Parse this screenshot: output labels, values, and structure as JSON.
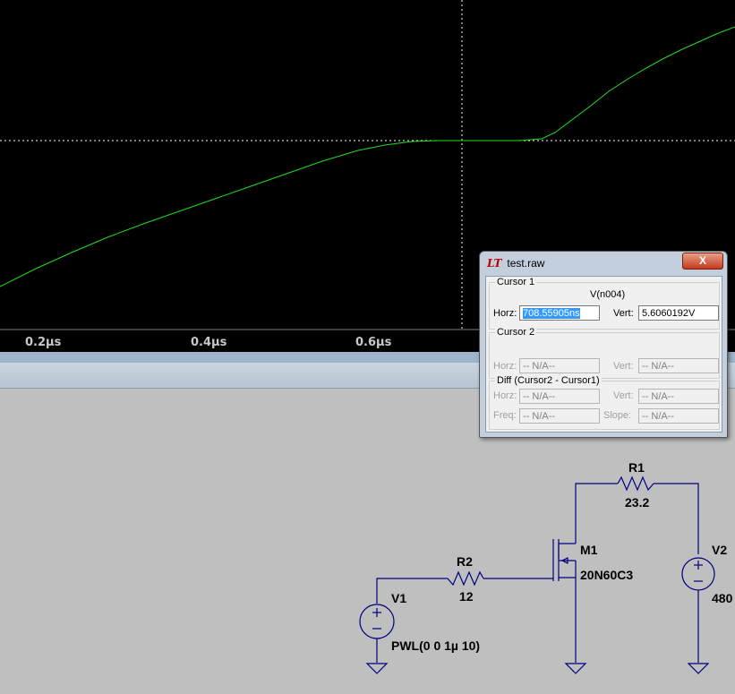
{
  "plot": {
    "x_ticks": [
      "0.2µs",
      "0.4µs",
      "0.6µs"
    ],
    "trace_color": "#00ff00",
    "background": "#000000"
  },
  "chart_data": {
    "type": "line",
    "series": [
      {
        "name": "V(n004)",
        "x": [
          0.0,
          0.1,
          0.2,
          0.3,
          0.4,
          0.45,
          0.5,
          0.55,
          0.6,
          0.65,
          0.7,
          0.75,
          0.8,
          0.85,
          0.9
        ],
        "y": [
          0.4,
          1.2,
          2.0,
          2.8,
          3.6,
          4.0,
          4.4,
          4.8,
          5.2,
          5.5,
          5.6,
          5.62,
          5.66,
          5.8,
          7.8
        ]
      }
    ],
    "xlim": [
      0.0,
      0.9
    ],
    "cursor": {
      "x": 0.70855905,
      "y": 5.6060192
    }
  },
  "dialog": {
    "title": "test.raw",
    "logo": "LT",
    "close": "X",
    "cursor1": {
      "title": "Cursor 1",
      "trace": "V(n004)",
      "horz_label": "Horz:",
      "horz_value": "708.55905ns",
      "vert_label": "Vert:",
      "vert_value": "5.6060192V"
    },
    "cursor2": {
      "title": "Cursor 2",
      "horz_label": "Horz:",
      "horz_value": "-- N/A--",
      "vert_label": "Vert:",
      "vert_value": "-- N/A--"
    },
    "diff": {
      "title": "Diff (Cursor2 - Cursor1)",
      "horz_label": "Horz:",
      "horz_value": "-- N/A--",
      "vert_label": "Vert:",
      "vert_value": "-- N/A--",
      "freq_label": "Freq:",
      "freq_value": "-- N/A--",
      "slope_label": "Slope:",
      "slope_value": "-- N/A--"
    }
  },
  "schematic": {
    "r1_name": "R1",
    "r1_value": "23.2",
    "r2_name": "R2",
    "r2_value": "12",
    "m1_name": "M1",
    "m1_model": "20N60C3",
    "v1_name": "V1",
    "v1_value": "PWL(0 0 1µ 10)",
    "v2_name": "V2",
    "v2_value": "480",
    "wire_color": "#000080"
  }
}
